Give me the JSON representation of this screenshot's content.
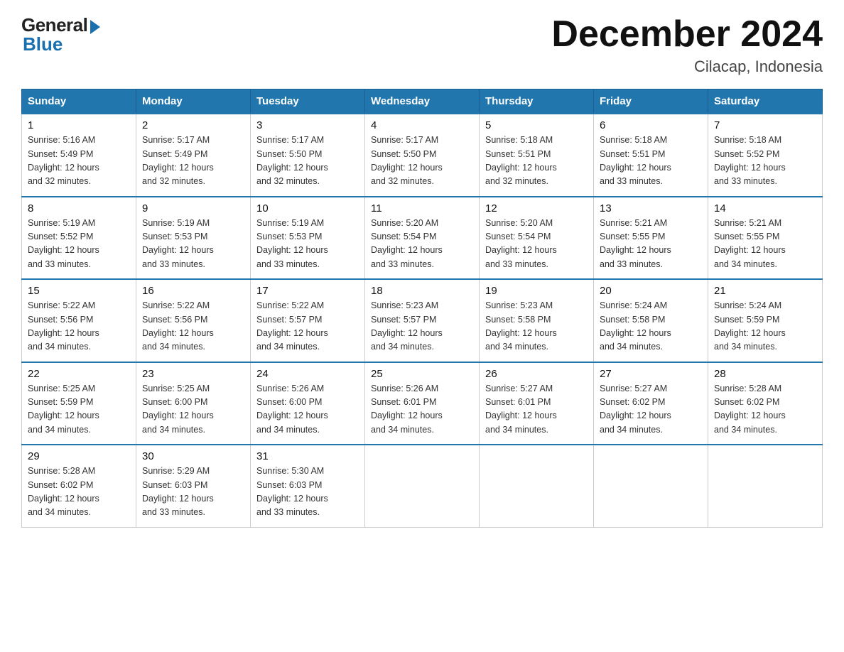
{
  "logo": {
    "general": "General",
    "blue": "Blue"
  },
  "header": {
    "title": "December 2024",
    "location": "Cilacap, Indonesia"
  },
  "weekdays": [
    "Sunday",
    "Monday",
    "Tuesday",
    "Wednesday",
    "Thursday",
    "Friday",
    "Saturday"
  ],
  "weeks": [
    [
      {
        "day": "1",
        "sunrise": "5:16 AM",
        "sunset": "5:49 PM",
        "daylight": "12 hours and 32 minutes."
      },
      {
        "day": "2",
        "sunrise": "5:17 AM",
        "sunset": "5:49 PM",
        "daylight": "12 hours and 32 minutes."
      },
      {
        "day": "3",
        "sunrise": "5:17 AM",
        "sunset": "5:50 PM",
        "daylight": "12 hours and 32 minutes."
      },
      {
        "day": "4",
        "sunrise": "5:17 AM",
        "sunset": "5:50 PM",
        "daylight": "12 hours and 32 minutes."
      },
      {
        "day": "5",
        "sunrise": "5:18 AM",
        "sunset": "5:51 PM",
        "daylight": "12 hours and 32 minutes."
      },
      {
        "day": "6",
        "sunrise": "5:18 AM",
        "sunset": "5:51 PM",
        "daylight": "12 hours and 33 minutes."
      },
      {
        "day": "7",
        "sunrise": "5:18 AM",
        "sunset": "5:52 PM",
        "daylight": "12 hours and 33 minutes."
      }
    ],
    [
      {
        "day": "8",
        "sunrise": "5:19 AM",
        "sunset": "5:52 PM",
        "daylight": "12 hours and 33 minutes."
      },
      {
        "day": "9",
        "sunrise": "5:19 AM",
        "sunset": "5:53 PM",
        "daylight": "12 hours and 33 minutes."
      },
      {
        "day": "10",
        "sunrise": "5:19 AM",
        "sunset": "5:53 PM",
        "daylight": "12 hours and 33 minutes."
      },
      {
        "day": "11",
        "sunrise": "5:20 AM",
        "sunset": "5:54 PM",
        "daylight": "12 hours and 33 minutes."
      },
      {
        "day": "12",
        "sunrise": "5:20 AM",
        "sunset": "5:54 PM",
        "daylight": "12 hours and 33 minutes."
      },
      {
        "day": "13",
        "sunrise": "5:21 AM",
        "sunset": "5:55 PM",
        "daylight": "12 hours and 33 minutes."
      },
      {
        "day": "14",
        "sunrise": "5:21 AM",
        "sunset": "5:55 PM",
        "daylight": "12 hours and 34 minutes."
      }
    ],
    [
      {
        "day": "15",
        "sunrise": "5:22 AM",
        "sunset": "5:56 PM",
        "daylight": "12 hours and 34 minutes."
      },
      {
        "day": "16",
        "sunrise": "5:22 AM",
        "sunset": "5:56 PM",
        "daylight": "12 hours and 34 minutes."
      },
      {
        "day": "17",
        "sunrise": "5:22 AM",
        "sunset": "5:57 PM",
        "daylight": "12 hours and 34 minutes."
      },
      {
        "day": "18",
        "sunrise": "5:23 AM",
        "sunset": "5:57 PM",
        "daylight": "12 hours and 34 minutes."
      },
      {
        "day": "19",
        "sunrise": "5:23 AM",
        "sunset": "5:58 PM",
        "daylight": "12 hours and 34 minutes."
      },
      {
        "day": "20",
        "sunrise": "5:24 AM",
        "sunset": "5:58 PM",
        "daylight": "12 hours and 34 minutes."
      },
      {
        "day": "21",
        "sunrise": "5:24 AM",
        "sunset": "5:59 PM",
        "daylight": "12 hours and 34 minutes."
      }
    ],
    [
      {
        "day": "22",
        "sunrise": "5:25 AM",
        "sunset": "5:59 PM",
        "daylight": "12 hours and 34 minutes."
      },
      {
        "day": "23",
        "sunrise": "5:25 AM",
        "sunset": "6:00 PM",
        "daylight": "12 hours and 34 minutes."
      },
      {
        "day": "24",
        "sunrise": "5:26 AM",
        "sunset": "6:00 PM",
        "daylight": "12 hours and 34 minutes."
      },
      {
        "day": "25",
        "sunrise": "5:26 AM",
        "sunset": "6:01 PM",
        "daylight": "12 hours and 34 minutes."
      },
      {
        "day": "26",
        "sunrise": "5:27 AM",
        "sunset": "6:01 PM",
        "daylight": "12 hours and 34 minutes."
      },
      {
        "day": "27",
        "sunrise": "5:27 AM",
        "sunset": "6:02 PM",
        "daylight": "12 hours and 34 minutes."
      },
      {
        "day": "28",
        "sunrise": "5:28 AM",
        "sunset": "6:02 PM",
        "daylight": "12 hours and 34 minutes."
      }
    ],
    [
      {
        "day": "29",
        "sunrise": "5:28 AM",
        "sunset": "6:02 PM",
        "daylight": "12 hours and 34 minutes."
      },
      {
        "day": "30",
        "sunrise": "5:29 AM",
        "sunset": "6:03 PM",
        "daylight": "12 hours and 33 minutes."
      },
      {
        "day": "31",
        "sunrise": "5:30 AM",
        "sunset": "6:03 PM",
        "daylight": "12 hours and 33 minutes."
      },
      null,
      null,
      null,
      null
    ]
  ],
  "labels": {
    "sunrise": "Sunrise: ",
    "sunset": "Sunset: ",
    "daylight": "Daylight: "
  }
}
